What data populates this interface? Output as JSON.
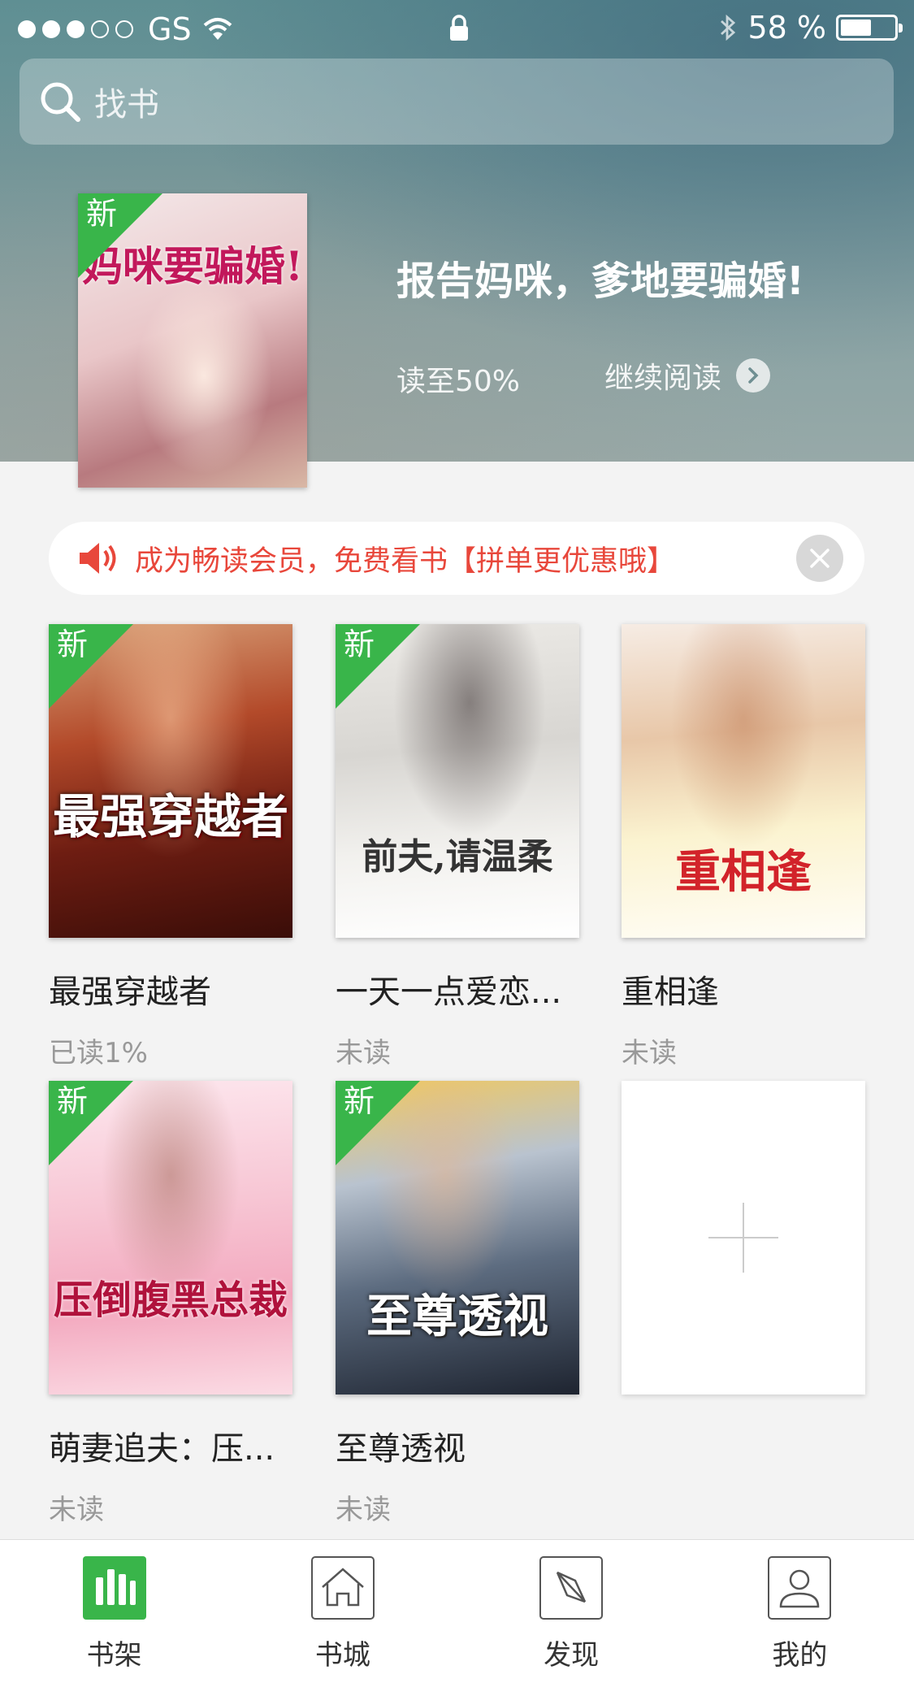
{
  "status_bar": {
    "carrier": "GS",
    "battery_percent_label": "58 %",
    "battery_level": 0.58
  },
  "search": {
    "placeholder": "找书"
  },
  "hero": {
    "title": "报告妈咪，爹地要骗婚!",
    "progress": "读至50%",
    "continue_label": "继续阅读",
    "cover_text": "妈咪要骗婚!",
    "new_tag": "新"
  },
  "notice": {
    "text": "成为畅读会员，免费看书【拼单更优惠哦】"
  },
  "books": [
    {
      "name": "最强穿越者",
      "status": "已读1%",
      "new_tag": "新",
      "cover_text": "最强穿越者"
    },
    {
      "name": "一天一点爱恋...",
      "status": "未读",
      "new_tag": "新",
      "cover_text": "前夫,请温柔"
    },
    {
      "name": "重相逢",
      "status": "未读",
      "new_tag": "",
      "cover_text": "重相逢"
    },
    {
      "name": "萌妻追夫：压...",
      "status": "未读",
      "new_tag": "新",
      "cover_text": "压倒腹黑总裁"
    },
    {
      "name": "至尊透视",
      "status": "未读",
      "new_tag": "新",
      "cover_text": "至尊透视"
    }
  ],
  "tabs": [
    {
      "label": "书架",
      "icon": "bookshelf-icon",
      "active": true
    },
    {
      "label": "书城",
      "icon": "bookstore-home-icon",
      "active": false
    },
    {
      "label": "发现",
      "icon": "compass-icon",
      "active": false
    },
    {
      "label": "我的",
      "icon": "profile-icon",
      "active": false
    }
  ],
  "colors": {
    "accent": "#39b54a",
    "notice_text": "#e8473b"
  }
}
